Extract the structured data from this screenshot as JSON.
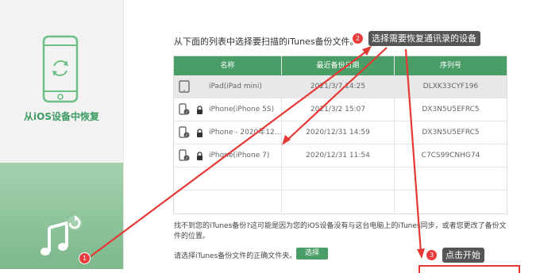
{
  "sidebar": {
    "title": "从iOS设备中恢复"
  },
  "main": {
    "instruction": "从下面的列表中选择要扫描的iTunes备份文件。",
    "table": {
      "headers": [
        "名称",
        "最近备份日期",
        "序列号"
      ],
      "rows": [
        {
          "name": "iPad(iPad mini)",
          "date": "2021/3/7 14:25",
          "serial": "DLXK33CYF196",
          "locked": false,
          "device": "ipad"
        },
        {
          "name": "iPhone(iPhone 5S)",
          "date": "2021/3/2 15:07",
          "serial": "DX3N5U5EFRC5",
          "locked": true,
          "device": "iphone"
        },
        {
          "name": "iPhone - 2020年12...",
          "date": "2020/12/31 14:59",
          "serial": "DX3N5U5EFRC5",
          "locked": true,
          "device": "iphone"
        },
        {
          "name": "iPhone(iPhone 7)",
          "date": "2020/12/31 11:54",
          "serial": "C7CS99CNHG74",
          "locked": true,
          "device": "iphone"
        }
      ]
    },
    "hint": "找不到您的iTunes备份?这可能是因为您的iOS设备没有与这台电脑上的iTunes同步，或者您更改了备份文件的位置。",
    "choose_prompt": "请选择iTunes备份文件的正确文件夹。",
    "choose_button": "选择"
  },
  "annotations": {
    "step1": {
      "number": "1"
    },
    "step2": {
      "number": "2",
      "text": "选择需要恢复通讯录的设备"
    },
    "step3": {
      "number": "3",
      "text": "点击开始"
    }
  },
  "colors": {
    "accent": "#4a9d66",
    "sidebar_accent": "#3e9b63",
    "annotation_red": "#e53935",
    "tooltip_bg": "#555555"
  }
}
